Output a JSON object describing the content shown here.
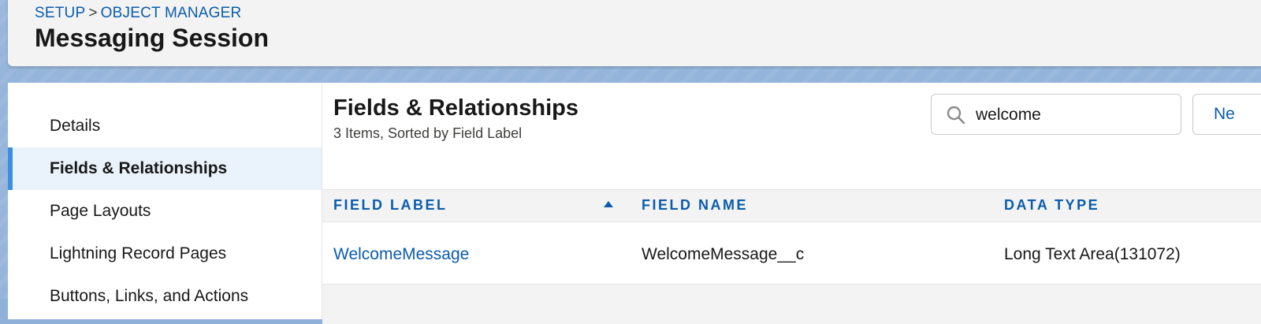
{
  "breadcrumb": {
    "setup": "SETUP",
    "separator": ">",
    "object_manager": "OBJECT MANAGER"
  },
  "header": {
    "title": "Messaging Session"
  },
  "sidebar": {
    "items": [
      {
        "label": "Details",
        "active": false
      },
      {
        "label": "Fields & Relationships",
        "active": true
      },
      {
        "label": "Page Layouts",
        "active": false
      },
      {
        "label": "Lightning Record Pages",
        "active": false
      },
      {
        "label": "Buttons, Links, and Actions",
        "active": false
      }
    ]
  },
  "main": {
    "title": "Fields & Relationships",
    "subtitle": "3 Items, Sorted by Field Label",
    "search": {
      "value": "welcome",
      "icon": "search-icon"
    },
    "new_button_label": "Ne"
  },
  "table": {
    "columns": [
      "FIELD LABEL",
      "FIELD NAME",
      "DATA TYPE"
    ],
    "sort": {
      "column": "FIELD LABEL",
      "direction": "ascending"
    },
    "rows": [
      {
        "field_label": "WelcomeMessage",
        "field_name": "WelcomeMessage__c",
        "data_type": "Long Text Area(131072)"
      }
    ]
  },
  "colors": {
    "link": "#0b5cab",
    "active_bar": "#3b8ee0",
    "active_bg": "#eaf2fc",
    "header_bg": "#f3f3f3"
  }
}
